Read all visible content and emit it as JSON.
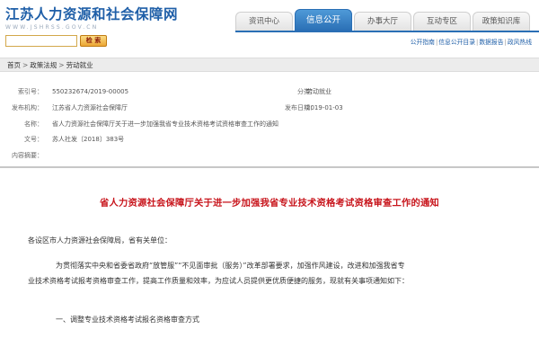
{
  "header": {
    "site_title": "江苏人力资源和社会保障网",
    "site_url": "WWW.JSHRSS.GOV.CN",
    "search_placeholder": "",
    "search_button": "检 索"
  },
  "nav": {
    "tabs": [
      {
        "label": "资讯中心"
      },
      {
        "label": "信息公开"
      },
      {
        "label": "办事大厅"
      },
      {
        "label": "互动专区"
      },
      {
        "label": "政策知识库"
      }
    ],
    "sublinks": [
      {
        "label": "公开指南"
      },
      {
        "label": "信息公开目录"
      },
      {
        "label": "数据报告"
      },
      {
        "label": "政风热线"
      }
    ]
  },
  "breadcrumb": {
    "items": [
      "首页",
      "政策法规",
      "劳动就业"
    ]
  },
  "meta": {
    "index_label": "索引号：",
    "index_value": "550232674/2019-00005",
    "category_label": "分类：",
    "category_value": "劳动就业",
    "publisher_label": "发布机构：",
    "publisher_value": "江苏省人力资源社会保障厅",
    "date_label": "发布日期：",
    "date_value": "2019-01-03",
    "name_label": "名称：",
    "name_value": "省人力资源社会保障厅关于进一步加强我省专业技术资格考试资格审查工作的通知",
    "docno_label": "文号：",
    "docno_value": "苏人社发〔2018〕383号",
    "summary_label": "内容摘要："
  },
  "article": {
    "title": "省人力资源社会保障厅关于进一步加强我省专业技术资格考试资格审查工作的通知",
    "salutation": "各设区市人力资源社会保障局，省有关单位：",
    "p1_line1": "为贯彻落实中央和省委省政府“放管服”“不见面审批（服务）”改革部署要求，加强作风建设，改进和加强我省专",
    "p1_line2": "业技术资格考试报考资格审查工作，提高工作质量和效率，为应试人员提供更优质便捷的服务，现就有关事项通知如下：",
    "section1": "一、调整专业技术资格考试报名资格审查方式"
  }
}
